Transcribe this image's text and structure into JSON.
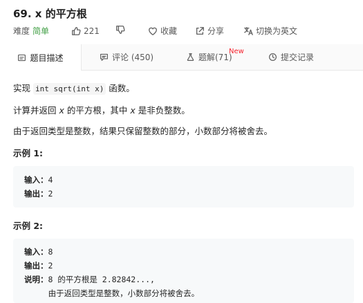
{
  "problem": {
    "title": "69. x 的平方根",
    "difficulty_label": "难度",
    "difficulty": "简单",
    "likes": "221",
    "favorite_label": "收藏",
    "share_label": "分享",
    "translate_label": "切换为英文"
  },
  "tabs": {
    "description": "题目描述",
    "comments": "评论 (450)",
    "solutions": "题解(71)",
    "solutions_badge": "New",
    "submissions": "提交记录"
  },
  "content": {
    "p1_pre": "实现 ",
    "p1_code": "int sqrt(int x)",
    "p1_post": " 函数。",
    "p2_a": "计算并返回 ",
    "p2_var1": "x",
    "p2_b": " 的平方根，其中 ",
    "p2_var2": "x",
    "p2_c": " 是非负整数。",
    "p3": "由于返回类型是整数，结果只保留整数的部分，小数部分将被舍去。",
    "example1_title": "示例 1:",
    "example2_title": "示例 2:"
  },
  "example1": {
    "input_label": "输入：",
    "input_value": "4",
    "output_label": "输出：",
    "output_value": "2"
  },
  "example2": {
    "input_label": "输入：",
    "input_value": "8",
    "output_label": "输出：",
    "output_value": "2",
    "explain_label": "说明：",
    "explain_line1": "8 的平方根是 2.82842...,",
    "explain_line2": "     由于返回类型是整数，小数部分将被舍去。"
  },
  "colors": {
    "easy": "#43a047",
    "new_badge": "#f5222d",
    "code_bg": "#f7f9fa"
  }
}
